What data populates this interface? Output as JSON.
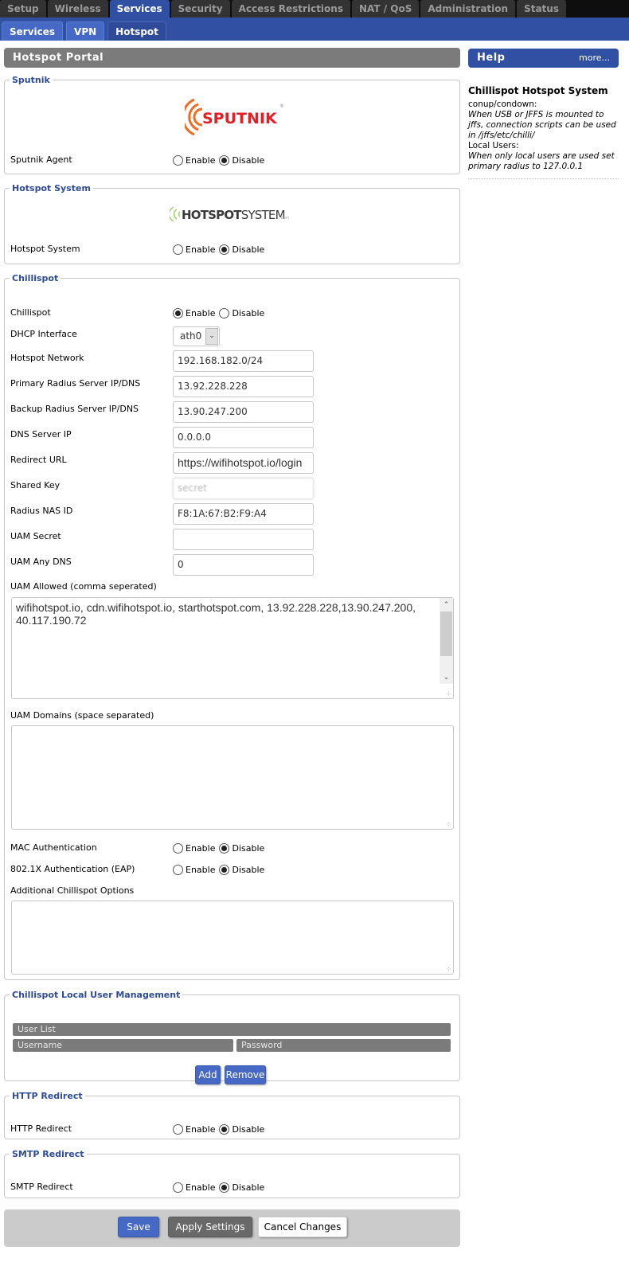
{
  "top_nav": {
    "tabs": [
      {
        "label": "Setup",
        "active": false
      },
      {
        "label": "Wireless",
        "active": false
      },
      {
        "label": "Services",
        "active": true
      },
      {
        "label": "Security",
        "active": false
      },
      {
        "label": "Access Restrictions",
        "active": false
      },
      {
        "label": "NAT / QoS",
        "active": false
      },
      {
        "label": "Administration",
        "active": false
      },
      {
        "label": "Status",
        "active": false
      }
    ]
  },
  "sub_nav": {
    "tabs": [
      {
        "label": "Services",
        "active": false
      },
      {
        "label": "VPN",
        "active": false
      },
      {
        "label": "Hotspot",
        "active": true
      }
    ]
  },
  "page_title": "Hotspot Portal",
  "radio_labels": {
    "enable": "Enable",
    "disable": "Disable"
  },
  "sputnik": {
    "legend": "Sputnik",
    "logo_text": "SPUTNIK",
    "agent_label": "Sputnik Agent",
    "agent_value": "Disable"
  },
  "hotspot_system": {
    "legend": "Hotspot System",
    "logo_text_a": "HOTSPOT",
    "logo_text_b": "SYSTEM",
    "label": "Hotspot System",
    "value": "Disable"
  },
  "chillispot": {
    "legend": "Chillispot",
    "enabled_label": "Chillispot",
    "enabled_value": "Enable",
    "dhcp_interface_label": "DHCP Interface",
    "dhcp_interface_value": "ath0",
    "hotspot_network_label": "Hotspot Network",
    "hotspot_network_value": "192.168.182.0/24",
    "primary_radius_label": "Primary Radius Server IP/DNS",
    "primary_radius_value": "13.92.228.228",
    "backup_radius_label": "Backup Radius Server IP/DNS",
    "backup_radius_value": "13.90.247.200",
    "dns_server_label": "DNS Server IP",
    "dns_server_value": "0.0.0.0",
    "redirect_url_label": "Redirect URL",
    "redirect_url_value": "https://wifihotspot.io/login",
    "shared_key_label": "Shared Key",
    "shared_key_value": "secret",
    "radius_nas_label": "Radius NAS ID",
    "radius_nas_value": "F8:1A:67:B2:F9:A4",
    "uam_secret_label": "UAM Secret",
    "uam_secret_value": "",
    "uam_any_dns_label": "UAM Any DNS",
    "uam_any_dns_value": "0",
    "uam_allowed_label": "UAM Allowed (comma seperated)",
    "uam_allowed_value": "wifihotspot.io, cdn.wifihotspot.io, starthotspot.com, 13.92.228.228,13.90.247.200, 40.117.190.72",
    "uam_domains_label": "UAM Domains (space separated)",
    "uam_domains_value": "",
    "mac_auth_label": "MAC Authentication",
    "mac_auth_value": "Disable",
    "eap_label": "802.1X Authentication (EAP)",
    "eap_value": "Disable",
    "additional_label": "Additional Chillispot Options",
    "additional_value": ""
  },
  "local_users": {
    "legend": "Chillispot Local User Management",
    "list_header": "User List",
    "col_username": "Username",
    "col_password": "Password",
    "add_label": "Add",
    "remove_label": "Remove"
  },
  "http_redirect": {
    "legend": "HTTP Redirect",
    "label": "HTTP Redirect",
    "value": "Disable"
  },
  "smtp_redirect": {
    "legend": "SMTP Redirect",
    "label": "SMTP Redirect",
    "value": "Disable"
  },
  "footer": {
    "save_label": "Save",
    "apply_label": "Apply Settings",
    "cancel_label": "Cancel Changes"
  },
  "help": {
    "title": "Help",
    "more_label": "more...",
    "heading": "Chillispot Hotspot System",
    "line1": "conup/condown:",
    "line2": "When USB or JFFS is mounted to jffs, connection scripts can be used in /jffs/etc/chilli/",
    "line3": "Local Users:",
    "line4": "When only local users are used set primary radius to 127.0.0.1"
  },
  "colors": {
    "brand_blue": "#3051a3",
    "header_gray": "#7b7b7b",
    "legend_blue": "#2d4b98",
    "button_blue": "#4569c4"
  }
}
